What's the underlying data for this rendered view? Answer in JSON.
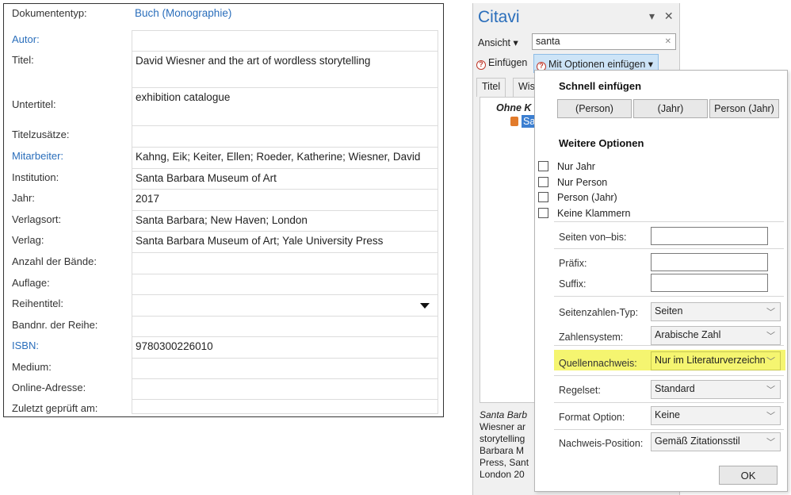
{
  "form": {
    "rows": [
      {
        "label": "Dokumententyp:",
        "value": "Buch (Monographie)"
      },
      {
        "label": "Autor:",
        "value": ""
      },
      {
        "label": "Titel:",
        "value": "David Wiesner and the art of wordless storytelling"
      },
      {
        "label": "Untertitel:",
        "value": "exhibition catalogue"
      },
      {
        "label": "Titelzusätze:",
        "value": ""
      },
      {
        "label": "Mitarbeiter:",
        "value": "Kahng, Eik; Keiter, Ellen; Roeder, Katherine; Wiesner, David"
      },
      {
        "label": "Institution:",
        "value": "Santa Barbara Museum of Art"
      },
      {
        "label": "Jahr:",
        "value": "2017"
      },
      {
        "label": "Verlagsort:",
        "value": "Santa Barbara; New Haven; London"
      },
      {
        "label": "Verlag:",
        "value": "Santa Barbara Museum of Art; Yale University Press"
      },
      {
        "label": "Anzahl der Bände:",
        "value": ""
      },
      {
        "label": "Auflage:",
        "value": ""
      },
      {
        "label": "Reihentitel:",
        "value": ""
      },
      {
        "label": "Bandnr. der Reihe:",
        "value": ""
      },
      {
        "label": "ISBN:",
        "value": "9780300226010"
      },
      {
        "label": "Medium:",
        "value": ""
      },
      {
        "label": "Online-Adresse:",
        "value": ""
      },
      {
        "label": "Zuletzt geprüft am:",
        "value": ""
      }
    ]
  },
  "citavi": {
    "title": "Citavi",
    "window_controls": "▾ ✕",
    "view_label": "Ansicht ▾",
    "search_value": "santa",
    "search_clear": "✕",
    "insert_label": "Einfügen",
    "insert_options_label": "Mit Optionen einfügen ▾",
    "tabs": [
      "Titel",
      "Wis"
    ],
    "tree_group": "Ohne K",
    "tree_item": "Sa",
    "preview_lines": [
      "Santa Barb",
      "Wiesner ar",
      "storytelling",
      "Barbara M",
      "Press, Sant",
      "London 20"
    ]
  },
  "options": {
    "quick_heading": "Schnell einfügen",
    "quick_buttons": [
      "(Person)",
      "(Jahr)",
      "Person (Jahr)"
    ],
    "more_heading": "Weitere Optionen",
    "checkboxes": [
      "Nur Jahr",
      "Nur Person",
      "Person (Jahr)",
      "Keine Klammern"
    ],
    "pages_label": "Seiten von–bis:",
    "prefix_label": "Präfix:",
    "suffix_label": "Suffix:",
    "page_type_label": "Seitenzahlen-Typ:",
    "page_type_value": "Seiten",
    "number_system_label": "Zahlensystem:",
    "number_system_value": "Arabische Zahl",
    "source_label": "Quellennachweis:",
    "source_value": "Nur im Literaturverzeichn",
    "ruleset_label": "Regelset:",
    "ruleset_value": "Standard",
    "format_label": "Format Option:",
    "format_value": "Keine",
    "position_label": "Nachweis-Position:",
    "position_value": "Gemäß Zitationsstil",
    "ok_label": "OK"
  },
  "colors": {
    "link": "#2a6ebb",
    "highlight": "#f5f570",
    "selection": "#3c7fd1",
    "option_button": "#cde4f7"
  }
}
